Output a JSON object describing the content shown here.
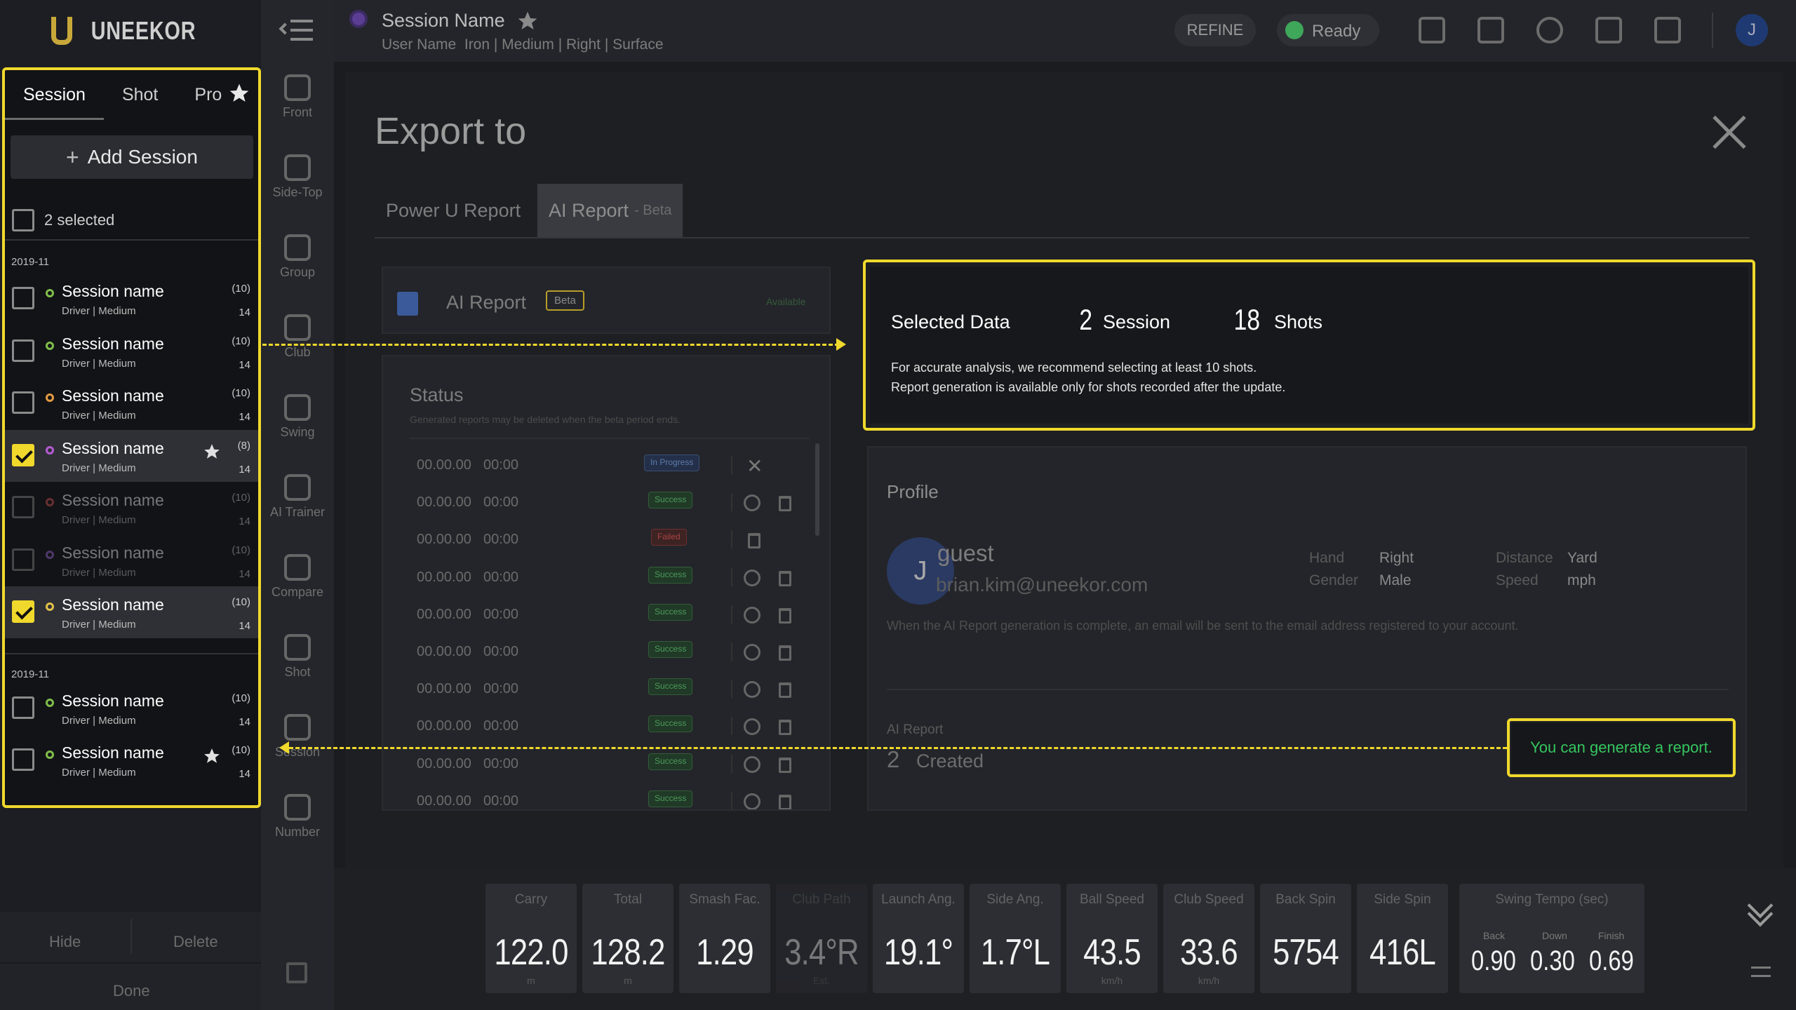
{
  "brand": {
    "name": "UNEEKOR"
  },
  "session_panel": {
    "tabs": [
      "Session",
      "Shot",
      "Pro"
    ],
    "add_session": "Add Session",
    "selected_label": "2 selected",
    "groups": [
      {
        "date": "2019-11",
        "rows": [
          {
            "name": "Session name",
            "sub": "Driver | Medium",
            "count": "(10)",
            "num": "14",
            "selected": false,
            "star": false,
            "dot": "#7fbe4a"
          },
          {
            "name": "Session name",
            "sub": "Driver | Medium",
            "count": "(10)",
            "num": "14",
            "selected": false,
            "star": false,
            "dot": "#7fbe4a"
          },
          {
            "name": "Session name",
            "sub": "Driver | Medium",
            "count": "(10)",
            "num": "14",
            "selected": false,
            "star": false,
            "dot": "#e29a42"
          },
          {
            "name": "Session name",
            "sub": "Driver | Medium",
            "count": "(8)",
            "num": "14",
            "selected": true,
            "star": true,
            "dot": "#b45bd2"
          },
          {
            "name": "Session name",
            "sub": "Driver | Medium",
            "count": "(10)",
            "num": "14",
            "selected": false,
            "star": false,
            "dot": "#e25757",
            "dim": true
          },
          {
            "name": "Session name",
            "sub": "Driver | Medium",
            "count": "(10)",
            "num": "14",
            "selected": false,
            "star": false,
            "dot": "#9f6ce0",
            "dim": true
          },
          {
            "name": "Session name",
            "sub": "Driver | Medium",
            "count": "(10)",
            "num": "14",
            "selected": true,
            "star": false,
            "dot": "#e2c24a"
          }
        ]
      },
      {
        "date": "2019-11",
        "rows": [
          {
            "name": "Session name",
            "sub": "Driver | Medium",
            "count": "(10)",
            "num": "14",
            "selected": false,
            "star": false,
            "dot": "#7fbe4a"
          },
          {
            "name": "Session name",
            "sub": "Driver | Medium",
            "count": "(10)",
            "num": "14",
            "selected": false,
            "star": true,
            "dot": "#7fbe4a"
          }
        ]
      }
    ],
    "hide": "Hide",
    "delete": "Delete",
    "done": "Done"
  },
  "icon_nav": [
    {
      "label": "Front",
      "icon": "front-view-icon"
    },
    {
      "label": "Side-Top",
      "icon": "side-top-view-icon"
    },
    {
      "label": "Group",
      "icon": "group-icon"
    },
    {
      "label": "Club",
      "icon": "club-icon"
    },
    {
      "label": "Swing",
      "icon": "camera-icon"
    },
    {
      "label": "AI Trainer",
      "icon": "ai-trainer-icon"
    },
    {
      "label": "Compare",
      "icon": "compare-icon"
    },
    {
      "label": "Shot",
      "icon": "shot-icon"
    },
    {
      "label": "Session",
      "icon": "session-icon"
    },
    {
      "label": "Number",
      "icon": "number-icon"
    }
  ],
  "topbar": {
    "session_name": "Session Name",
    "meta": "User Name  Iron | Medium | Right | Surface",
    "refine": "REFINE",
    "status": "Ready",
    "avatar": "J"
  },
  "modal": {
    "title": "Export to",
    "tabs": [
      {
        "label": "Power U Report"
      },
      {
        "label": "AI Report",
        "suffix": "- Beta"
      }
    ],
    "report_card": {
      "title": "AI Report",
      "badge": "Beta",
      "available": "Available"
    },
    "status": {
      "title": "Status",
      "note": "Generated reports may be deleted when the beta period ends.",
      "rows": [
        {
          "date": "00.00.00",
          "time": "00:00",
          "state": "In Progress",
          "type": "prog"
        },
        {
          "date": "00.00.00",
          "time": "00:00",
          "state": "Success",
          "type": "ok"
        },
        {
          "date": "00.00.00",
          "time": "00:00",
          "state": "Failed",
          "type": "fail"
        },
        {
          "date": "00.00.00",
          "time": "00:00",
          "state": "Success",
          "type": "ok"
        },
        {
          "date": "00.00.00",
          "time": "00:00",
          "state": "Success",
          "type": "ok"
        },
        {
          "date": "00.00.00",
          "time": "00:00",
          "state": "Success",
          "type": "ok"
        },
        {
          "date": "00.00.00",
          "time": "00:00",
          "state": "Success",
          "type": "ok"
        },
        {
          "date": "00.00.00",
          "time": "00:00",
          "state": "Success",
          "type": "ok"
        },
        {
          "date": "00.00.00",
          "time": "00:00",
          "state": "Success",
          "type": "ok"
        },
        {
          "date": "00.00.00",
          "time": "00:00",
          "state": "Success",
          "type": "ok"
        }
      ]
    },
    "selected_data": {
      "label": "Selected Data",
      "sessions": "2",
      "sessions_label": "Session",
      "shots": "18",
      "shots_label": "Shots",
      "note1": "For accurate analysis, we recommend selecting at least 10 shots.",
      "note2": "Report generation is available only for shots recorded after the update."
    },
    "profile": {
      "title": "Profile",
      "initial": "J",
      "name": "guest",
      "email": "brian.kim@uneekor.com",
      "hand_label": "Hand",
      "hand": "Right",
      "gender_label": "Gender",
      "gender": "Male",
      "distance_label": "Distance",
      "distance": "Yard",
      "speed_label": "Speed",
      "speed": "mph",
      "note": "When the AI Report generation is complete, an email will be sent to the email address registered to your account.",
      "ai_report_label": "AI Report",
      "created_count": "2",
      "created_label": "Created",
      "generate_msg": "You can generate a report."
    }
  },
  "metrics": [
    {
      "label": "Carry",
      "value": "122.0",
      "unit": "m"
    },
    {
      "label": "Total",
      "value": "128.2",
      "unit": "m"
    },
    {
      "label": "Smash Fac.",
      "value": "1.29",
      "unit": ""
    },
    {
      "label": "Club Path",
      "value": "3.4°R",
      "unit": "Est.",
      "dim": true
    },
    {
      "label": "Launch Ang.",
      "value": "19.1°",
      "unit": ""
    },
    {
      "label": "Side Ang.",
      "value": "1.7°L",
      "unit": ""
    },
    {
      "label": "Ball Speed",
      "value": "43.5",
      "unit": "km/h"
    },
    {
      "label": "Club Speed",
      "value": "33.6",
      "unit": "km/h"
    },
    {
      "label": "Back Spin",
      "value": "5754",
      "unit": ""
    },
    {
      "label": "Side Spin",
      "value": "416L",
      "unit": ""
    }
  ],
  "swing_tempo": {
    "label": "Swing Tempo (sec)",
    "back_label": "Back",
    "back": "0.90",
    "down_label": "Down",
    "down": "0.30",
    "finish_label": "Finish",
    "finish": "0.69"
  },
  "colors": {
    "highlight": "#f0d92c",
    "success": "#35c65f",
    "accent_check": "#f0d92c"
  }
}
